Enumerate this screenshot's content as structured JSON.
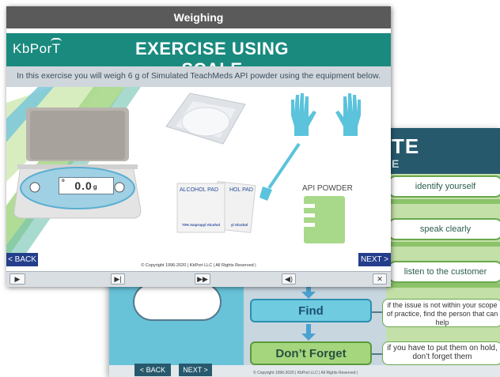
{
  "background_window": {
    "title_fragment": "TE",
    "subtitle_fragment": "E",
    "pills": [
      "identify yourself",
      "speak clearly",
      "listen to the customer"
    ],
    "flow": {
      "find": "Find",
      "dont_forget": "Don’t Forget"
    },
    "notes": {
      "find": "if the issue is not within your scope of practice, find the person that can help",
      "dont_forget": "if you have to put them on hold, don’t forget them"
    },
    "nav": {
      "back": "< BACK",
      "next": "NEXT >"
    },
    "copyright": "© Copyright 1996-2020 | KbPort LLC | All Rights Reserved |"
  },
  "front_window": {
    "window_title": "Weighing",
    "logo": "KbPorT",
    "heading": "EXERCISE USING SCALE",
    "instruction": "In this exercise you will weigh 6 g of Simulated TeachMeds API powder using the equipment below.",
    "scale": {
      "reading": "0.0",
      "unit": "g",
      "indicator": "o"
    },
    "alcohol_pad": {
      "label_front": "ALCOHOL PAD",
      "label_back": "HOL PAD",
      "foot_front": "70% Isopropyl Alcohol",
      "foot_back": "yl Alcohol"
    },
    "api_powder_label": "API POWDER",
    "nav": {
      "back": "< BACK",
      "next": "NEXT >"
    },
    "copyright": "© Copyright 1996-2020 | KbPort LLC | All Rights Reserved |",
    "controls": {
      "play": "▶",
      "step": "▶|",
      "fast_forward": "▶▶",
      "volume": "◀)",
      "close": "✕"
    }
  },
  "colors": {
    "title_bar": "#5a5a5a",
    "header_teal": "#1a8a7f",
    "nav_blue": "#243e8c",
    "bg_header": "#27596d",
    "scale_blue": "#5aaed0",
    "glove_cyan": "#5bc3dc",
    "pad_green": "#a8d88a"
  }
}
